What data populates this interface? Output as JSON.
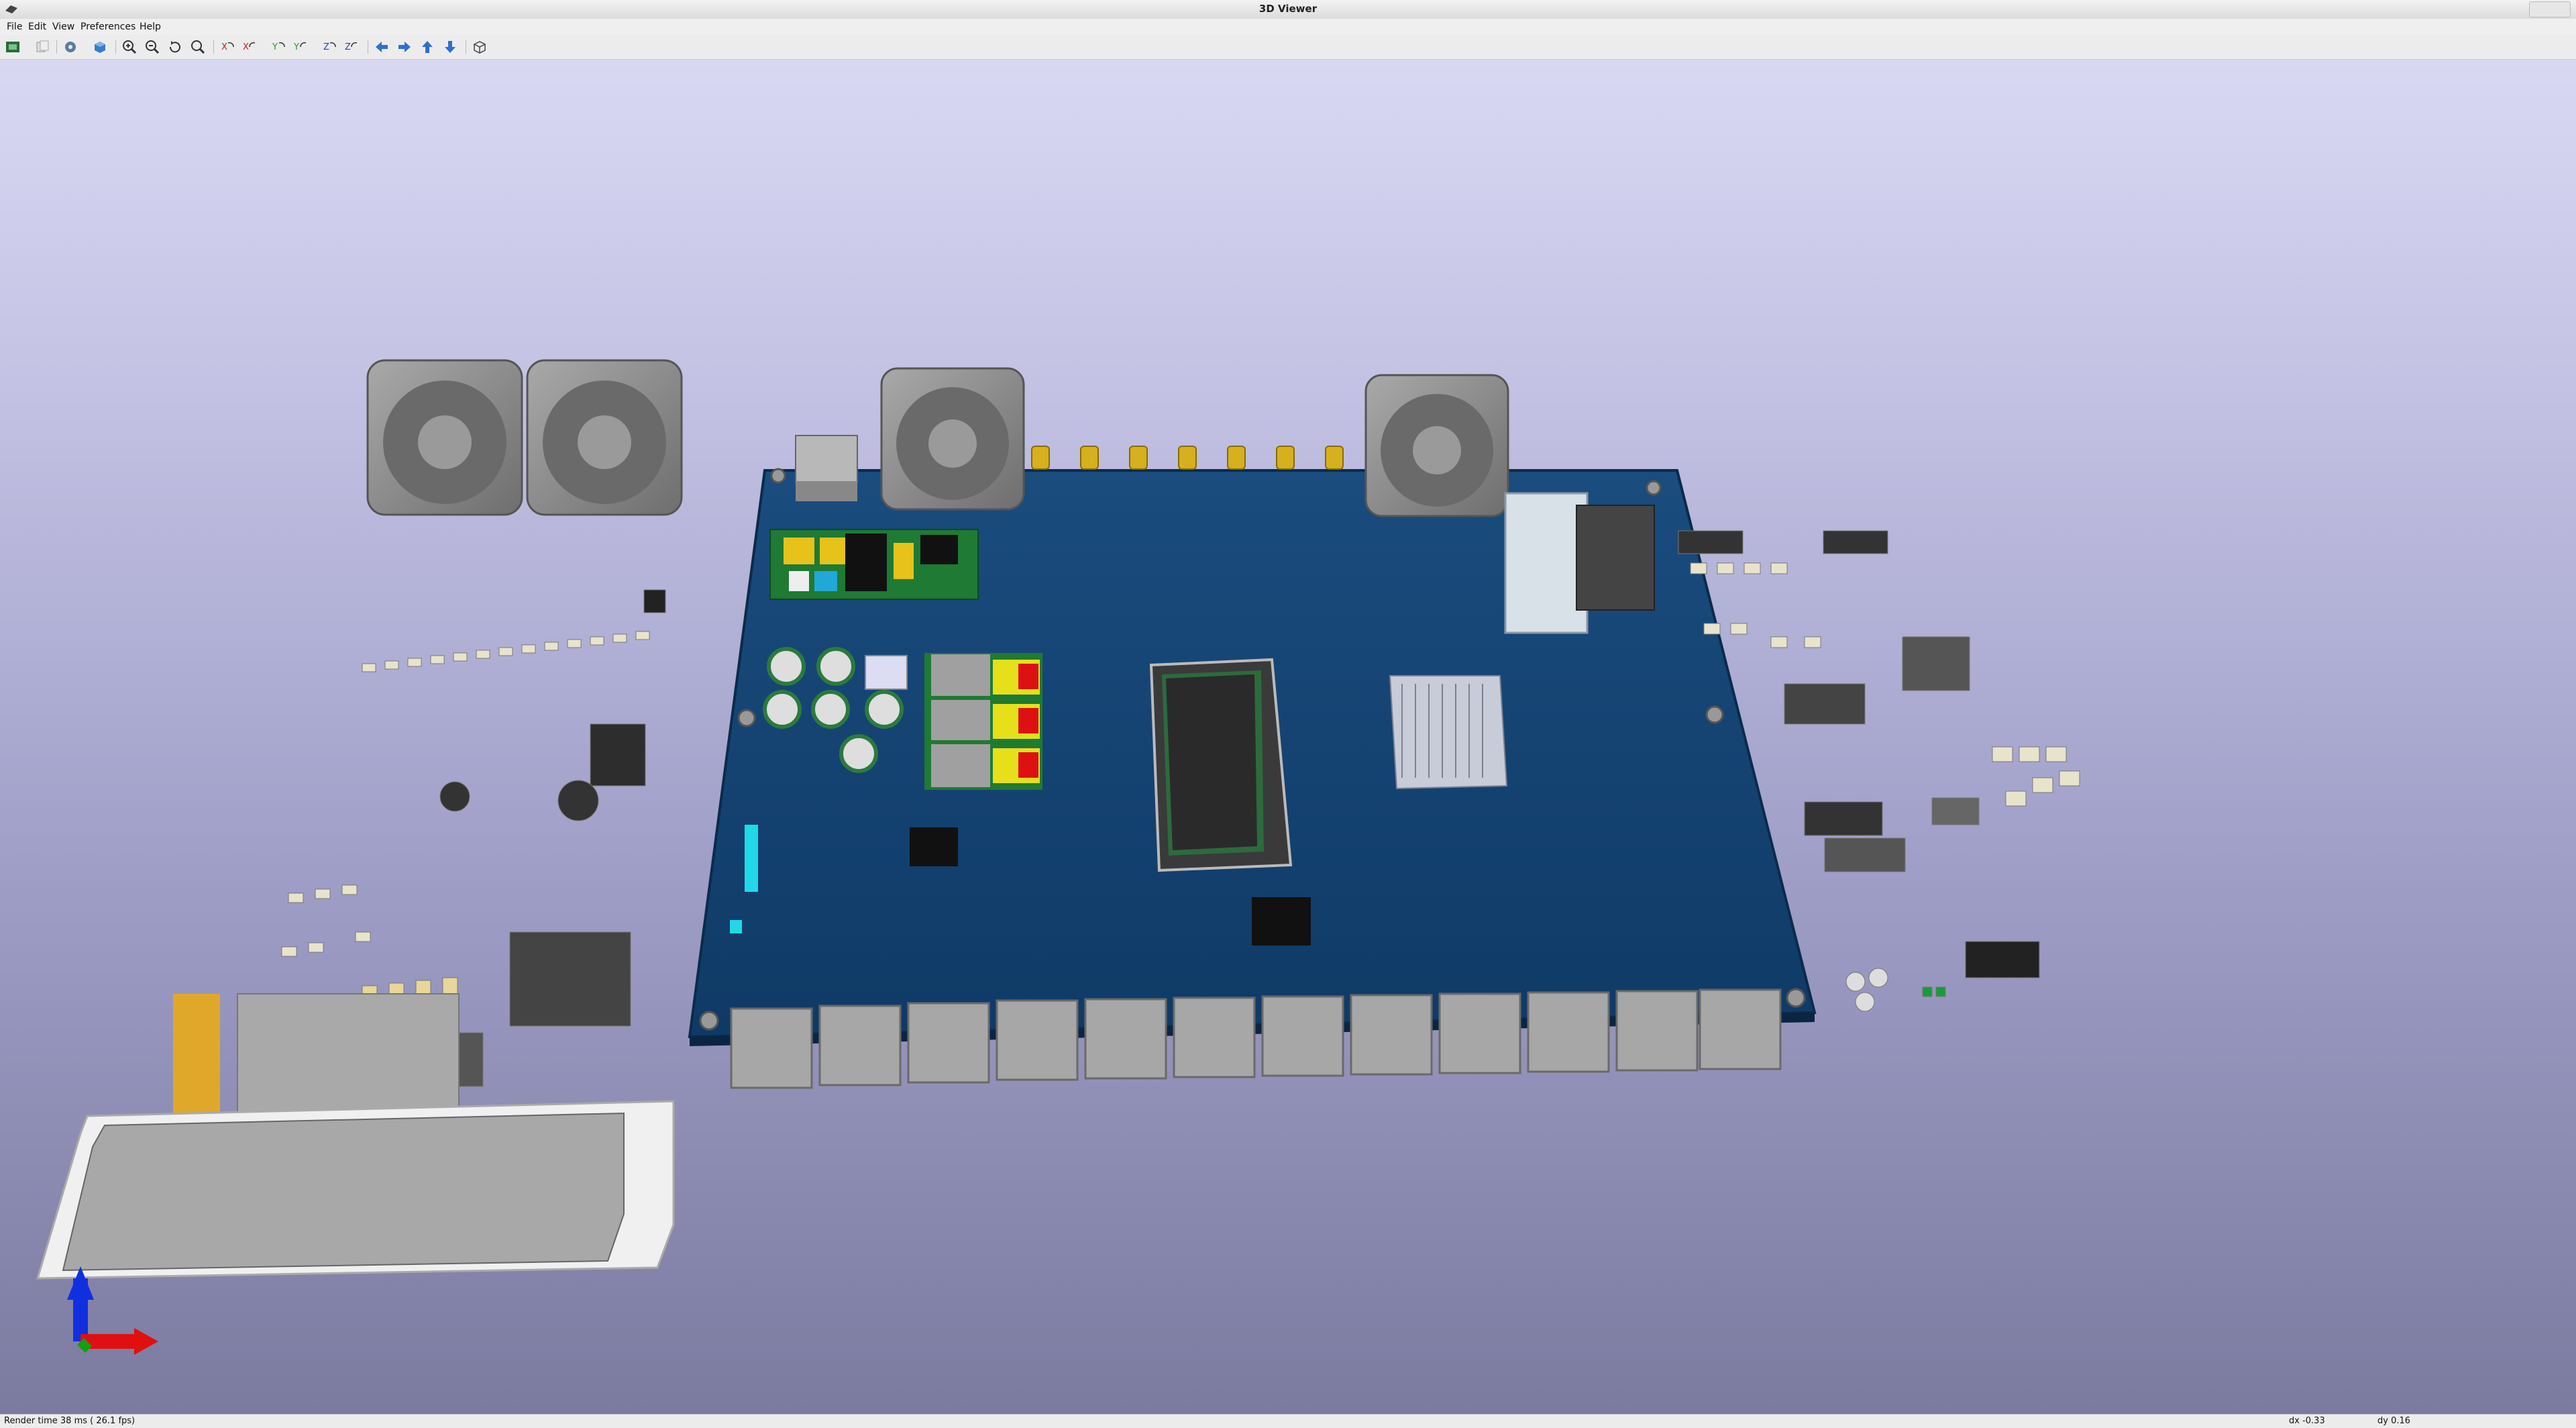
{
  "window": {
    "title": "3D Viewer"
  },
  "menu": [
    "File",
    "Edit",
    "View",
    "Preferences",
    "Help"
  ],
  "toolbar": {
    "buttons": [
      {
        "name": "reload-board-button",
        "icon": "reload-icon"
      },
      {
        "name": "copy-image-button",
        "icon": "copy-icon"
      },
      {
        "name": "settings-button",
        "icon": "gear-icon"
      },
      {
        "name": "raytracing-button",
        "icon": "render-icon"
      },
      {
        "name": "zoom-in-button",
        "icon": "zoom-in-icon"
      },
      {
        "name": "zoom-out-button",
        "icon": "zoom-out-icon"
      },
      {
        "name": "redraw-button",
        "icon": "redraw-icon"
      },
      {
        "name": "zoom-fit-button",
        "icon": "zoom-fit-icon"
      },
      {
        "name": "rotate-x-cw-button",
        "icon": "rotate-x-icon"
      },
      {
        "name": "rotate-x-ccw-button",
        "icon": "rotate-x-icon"
      },
      {
        "name": "rotate-y-cw-button",
        "icon": "rotate-y-icon"
      },
      {
        "name": "rotate-y-ccw-button",
        "icon": "rotate-y-icon"
      },
      {
        "name": "rotate-z-cw-button",
        "icon": "rotate-z-icon"
      },
      {
        "name": "rotate-z-ccw-button",
        "icon": "rotate-z-icon"
      },
      {
        "name": "flip-board-button",
        "icon": "flip-icon"
      },
      {
        "name": "pan-left-button",
        "icon": "arrow-left-icon"
      },
      {
        "name": "pan-right-button",
        "icon": "arrow-right-icon"
      },
      {
        "name": "pan-up-button",
        "icon": "arrow-up-icon"
      },
      {
        "name": "pan-down-button",
        "icon": "arrow-down-icon"
      },
      {
        "name": "ortho-toggle-button",
        "icon": "ortho-icon"
      }
    ]
  },
  "colors": {
    "board": "#123f6c",
    "board_edge": "#0b2b4c",
    "viewport_top": "#d9d8f3",
    "viewport_bottom": "#7b7a9f",
    "fan": "#8c8c8c",
    "connector_gold": "#d6b01e",
    "axis_x": "#e01010",
    "axis_y": "#10a010",
    "axis_z": "#1030e0"
  },
  "status": {
    "render_time": "Render time 38 ms ( 26.1 fps)",
    "dx": "dx -0.33",
    "dy": "dy 0.16"
  }
}
